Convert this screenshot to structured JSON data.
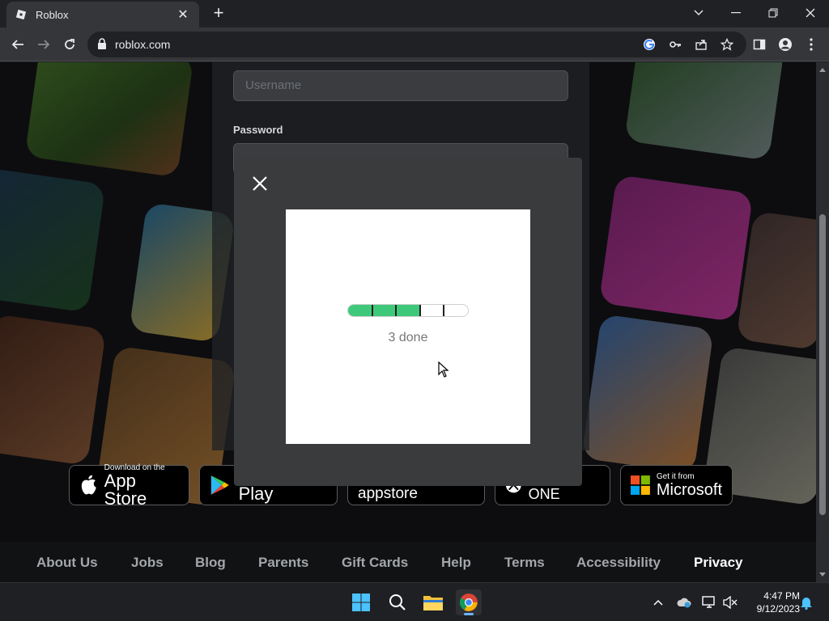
{
  "browser": {
    "tab_title": "Roblox",
    "url": "roblox.com"
  },
  "login": {
    "username_placeholder": "Username",
    "password_label": "Password"
  },
  "badges": [
    {
      "small": "Download on the",
      "big": "App Store"
    },
    {
      "small": "",
      "big": "Google Play"
    },
    {
      "small": "",
      "big": "amazon appstore"
    },
    {
      "small": "",
      "big": "XBOX ONE"
    },
    {
      "small": "Get it from",
      "big": "Microsoft"
    }
  ],
  "footer": {
    "links": [
      "About Us",
      "Jobs",
      "Blog",
      "Parents",
      "Gift Cards",
      "Help",
      "Terms",
      "Accessibility",
      "Privacy"
    ]
  },
  "challenge": {
    "progress_label": "3 done",
    "progress_done": 3,
    "progress_total": 5,
    "progress_color": "#3ec97a"
  },
  "taskbar": {
    "time": "4:47 PM",
    "date": "9/12/2023"
  }
}
